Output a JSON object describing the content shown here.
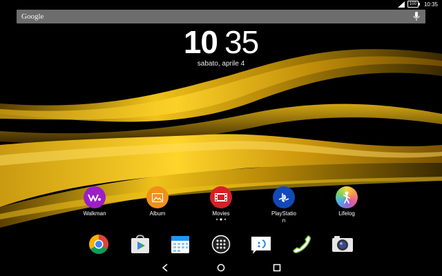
{
  "status_bar": {
    "time": "10:35",
    "battery_level": "100",
    "icons": [
      "signal-icon",
      "battery-icon"
    ]
  },
  "search_bar": {
    "label": "Google",
    "icon": "mic-icon"
  },
  "clock_widget": {
    "hour": "10",
    "minute": "35",
    "date": "sabato, aprile 4"
  },
  "apps": [
    {
      "label": "Walkman",
      "icon": "walkman-icon",
      "color": "#9c1fc4"
    },
    {
      "label": "Album",
      "icon": "album-icon",
      "color": "#f0901a"
    },
    {
      "label": "Movies",
      "icon": "movies-icon",
      "color": "#d81f26"
    },
    {
      "label": "PlayStation",
      "label_display": "PlayStatio\nn",
      "icon": "playstation-icon",
      "color": "#1249b8"
    },
    {
      "label": "Lifelog",
      "icon": "lifelog-icon",
      "color": "#c6e8d8"
    }
  ],
  "page_indicator": {
    "pages": 3,
    "current": 2
  },
  "dock": [
    {
      "name": "chrome-icon"
    },
    {
      "name": "play-store-icon"
    },
    {
      "name": "calendar-icon"
    },
    {
      "name": "app-drawer-icon"
    },
    {
      "name": "messaging-icon"
    },
    {
      "name": "phone-icon"
    },
    {
      "name": "camera-icon"
    }
  ],
  "nav_bar": [
    "back-icon",
    "home-icon",
    "recents-icon"
  ],
  "colors": {
    "gold": "#f2c11a",
    "gold_dark": "#7a5a00",
    "search_bar": "#6d6d6d"
  }
}
